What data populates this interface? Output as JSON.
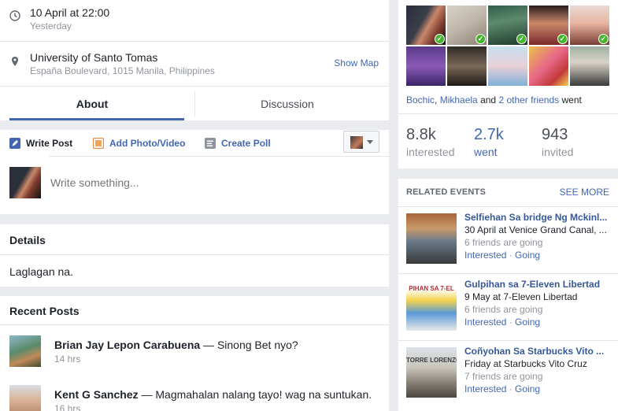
{
  "info": {
    "time_main": "10 April at 22:00",
    "time_sub": "Yesterday",
    "location_main": "University of Santo Tomas",
    "location_sub": "España Boulevard, 1015 Manila, Philippines",
    "show_map": "Show Map"
  },
  "tabs": [
    {
      "label": "About"
    },
    {
      "label": "Discussion"
    }
  ],
  "composer": {
    "write_post": "Write Post",
    "add_photo": "Add Photo/Video",
    "create_poll": "Create Poll",
    "placeholder": "Write something..."
  },
  "details": {
    "title": "Details",
    "text": "Laglagan na."
  },
  "recent_posts": {
    "title": "Recent Posts",
    "items": [
      {
        "author": "Brian Jay Lepon Carabuena",
        "text": " — Sinong Bet nyo?",
        "time": "14 hrs"
      },
      {
        "author": "Kent G Sanchez",
        "text": " — Magmahalan nalang tayo! wag na suntukan.",
        "time": "16 hrs"
      }
    ]
  },
  "friends": {
    "name1": "Bochic",
    "sep": ", ",
    "name2": "Mikhaela",
    "and": " and ",
    "others": "2 other friends",
    "went": " went"
  },
  "stats": {
    "interested": {
      "num": "8.8k",
      "label": "interested"
    },
    "went": {
      "num": "2.7k",
      "label": "went"
    },
    "invited": {
      "num": "943",
      "label": "invited"
    }
  },
  "related": {
    "title": "RELATED EVENTS",
    "see_more": "SEE MORE",
    "events": [
      {
        "title": "Selfiehan Sa bridge Ng Mckinl...",
        "date": "30 April at Venice Grand Canal, ...",
        "friends": "6 friends are going",
        "interested": "Interested",
        "going": "Going"
      },
      {
        "title": "Gulpihan sa 7-Eleven Libertad",
        "date": "9 May at 7-Eleven Libertad",
        "friends": "6 friends are going",
        "interested": "Interested",
        "going": "Going"
      },
      {
        "title": "Coñyohan Sa Starbucks Vito ...",
        "date": "Friday at Starbucks Vito Cruz",
        "friends": "7 friends are going",
        "interested": "Interested",
        "going": "Going"
      }
    ],
    "img2_text": "PIHAN SA 7-EL",
    "img3_text": "TORRE LORENZO"
  },
  "colors": {
    "accent": "#4267b2",
    "check": "#42b72a"
  }
}
